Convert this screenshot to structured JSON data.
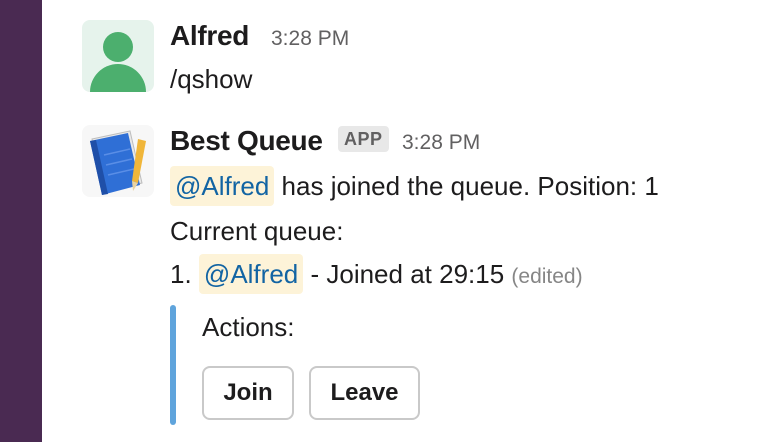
{
  "messages": [
    {
      "sender": "Alfred",
      "time": "3:28 PM",
      "text": "/qshow",
      "avatar_icon": "user-avatar-icon"
    },
    {
      "sender": "Best Queue",
      "badge": "APP",
      "time": "3:28 PM",
      "avatar_icon": "notebook-pencil-icon",
      "line1": {
        "mention": "@Alfred",
        "rest": " has joined the queue. Position: 1"
      },
      "line2": "Current queue:",
      "line3": {
        "prefix": "1. ",
        "mention": "@Alfred",
        "rest": " - Joined at 29:15 ",
        "edited": "(edited)"
      },
      "attachment": {
        "label": "Actions:",
        "buttons": [
          "Join",
          "Leave"
        ]
      }
    }
  ],
  "colors": {
    "sidebar": "#4a2a52",
    "mention_bg": "#fdf3d8",
    "mention_text": "#1264a3",
    "attachment_bar": "#5fa4dc"
  }
}
